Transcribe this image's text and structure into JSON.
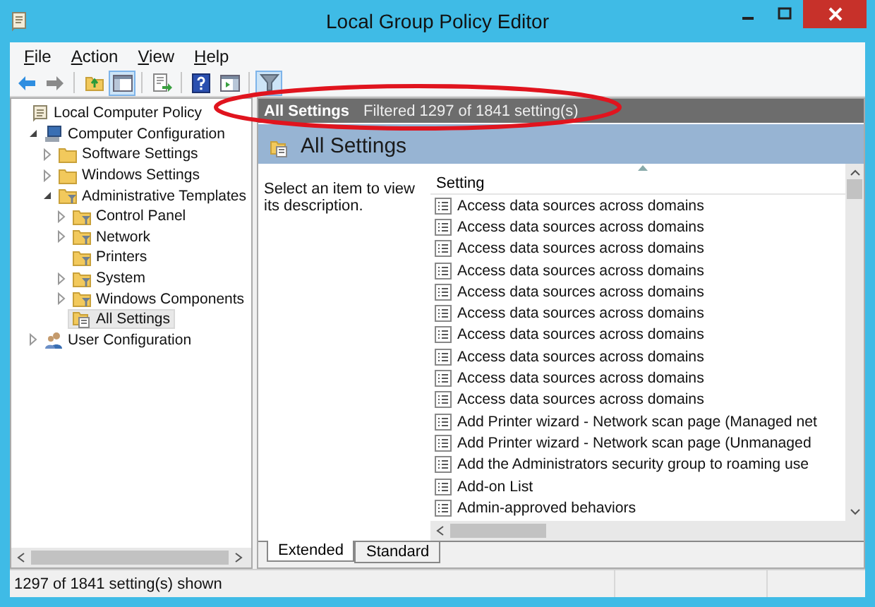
{
  "window": {
    "title": "Local Group Policy Editor"
  },
  "menu": [
    "File",
    "Action",
    "View",
    "Help"
  ],
  "toolbar": [
    {
      "kind": "button",
      "pressed": false
    },
    {
      "kind": "button",
      "pressed": false
    },
    {
      "kind": "separator"
    },
    {
      "kind": "button",
      "pressed": false
    },
    {
      "kind": "button",
      "pressed": true
    },
    {
      "kind": "separator"
    },
    {
      "kind": "button",
      "pressed": false
    },
    {
      "kind": "separator"
    },
    {
      "kind": "button",
      "pressed": false
    },
    {
      "kind": "button",
      "pressed": false
    },
    {
      "kind": "separator"
    },
    {
      "kind": "button",
      "pressed": true
    }
  ],
  "tree": [
    {
      "label": "Local Computer Policy",
      "kind": "policy",
      "selected": false,
      "children": [
        {
          "label": "Computer Configuration",
          "kind": "computer",
          "selected": false,
          "expanded": true,
          "children": [
            {
              "label": "Software Settings",
              "kind": "folder",
              "selected": false,
              "expanded": false
            },
            {
              "label": "Windows Settings",
              "kind": "folder",
              "selected": false,
              "expanded": false
            },
            {
              "label": "Administrative Templates",
              "kind": "template",
              "selected": false,
              "expanded": true,
              "children": [
                {
                  "label": "Control Panel",
                  "kind": "template",
                  "selected": false,
                  "expanded": false
                },
                {
                  "label": "Network",
                  "kind": "template",
                  "selected": false,
                  "expanded": false
                },
                {
                  "label": "Printers",
                  "kind": "template",
                  "selected": false
                },
                {
                  "label": "System",
                  "kind": "template",
                  "selected": false,
                  "expanded": false
                },
                {
                  "label": "Windows Components",
                  "kind": "template",
                  "selected": false,
                  "expanded": false
                },
                {
                  "label": "All Settings",
                  "kind": "settings",
                  "selected": true
                }
              ]
            }
          ]
        },
        {
          "label": "User Configuration",
          "kind": "user",
          "selected": false,
          "expanded": false
        }
      ]
    }
  ],
  "header_bar": {
    "title": "All Settings",
    "filter": "Filtered 1297 of 1841 setting(s)"
  },
  "band_title": "All Settings",
  "description": "Select an item to view its description.",
  "table": {
    "columns": [
      "Setting"
    ],
    "rows": [
      "Access data sources across domains",
      "Access data sources across domains",
      "Access data sources across domains",
      "Access data sources across domains",
      "Access data sources across domains",
      "Access data sources across domains",
      "Access data sources across domains",
      "Access data sources across domains",
      "Access data sources across domains",
      "Access data sources across domains",
      "Add Printer wizard - Network scan page (Managed net",
      "Add Printer wizard - Network scan page (Unmanaged",
      "Add the Administrators security group to roaming use",
      "Add-on List",
      "Admin-approved behaviors"
    ]
  },
  "tabs": [
    {
      "label": "Extended",
      "selected": true
    },
    {
      "label": "Standard",
      "selected": false
    }
  ],
  "status_bar": "1297 of 1841 setting(s) shown"
}
